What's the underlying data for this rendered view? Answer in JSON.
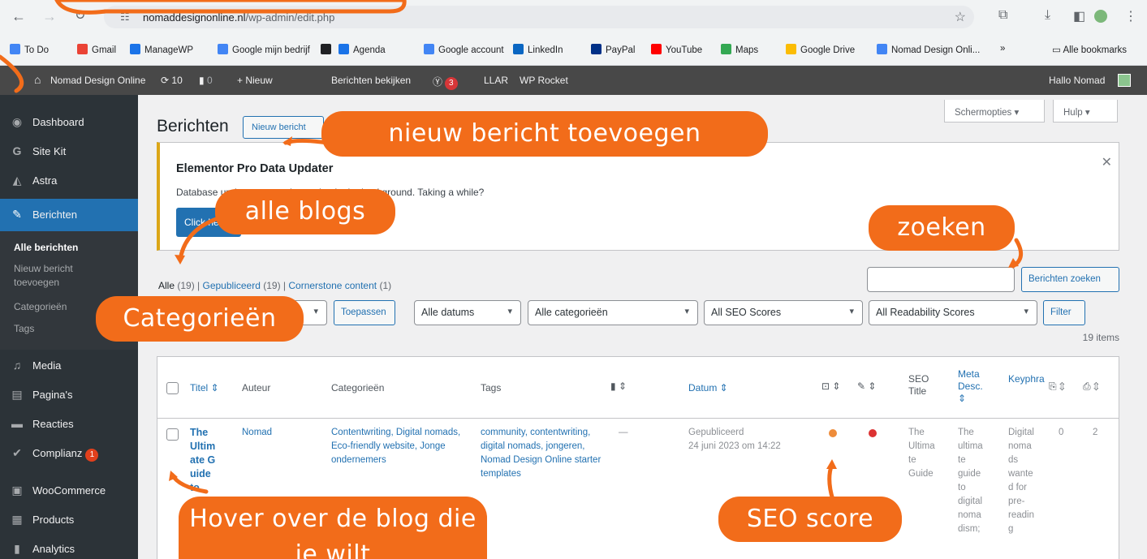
{
  "browser": {
    "url_host": "nomaddesignonline.nl",
    "url_path": "/wp-admin/edit.php",
    "bookmarks": [
      {
        "label": "To Do",
        "color": "#4285f4"
      },
      {
        "label": "Gmail",
        "color": "#ea4335"
      },
      {
        "label": "ManageWP",
        "color": "#1a73e8"
      },
      {
        "label": "Google mijn bedrijf",
        "color": "#4285f4"
      },
      {
        "label": "",
        "color": "#202124"
      },
      {
        "label": "Agenda",
        "color": "#1a73e8"
      },
      {
        "label": "Google account",
        "color": "#4285f4"
      },
      {
        "label": "LinkedIn",
        "color": "#0a66c2"
      },
      {
        "label": "PayPal",
        "color": "#003087"
      },
      {
        "label": "YouTube",
        "color": "#ff0000"
      },
      {
        "label": "Maps",
        "color": "#34a853"
      },
      {
        "label": "Google Drive",
        "color": "#fbbc04"
      },
      {
        "label": "Nomad Design Onli...",
        "color": "#4285f4"
      }
    ],
    "more_bookmarks": "»",
    "all_bookmarks": "Alle bookmarks"
  },
  "adminbar": {
    "site_name": "Nomad Design Online",
    "updates": "10",
    "comments": "0",
    "new": "+ Nieuw",
    "view_posts": "Berichten bekijken",
    "yoast_badge": "3",
    "llar": "LLAR",
    "wp_rocket": "WP Rocket",
    "greeting": "Hallo Nomad"
  },
  "sidebar": {
    "items": [
      {
        "label": "Dashboard",
        "icon": "dashboard-icon"
      },
      {
        "label": "Site Kit",
        "icon": "sitekit-icon"
      },
      {
        "label": "Astra",
        "icon": "astra-icon"
      },
      {
        "label": "Berichten",
        "icon": "pin-icon"
      },
      {
        "label": "Media",
        "icon": "media-icon"
      },
      {
        "label": "Pagina's",
        "icon": "page-icon"
      },
      {
        "label": "Reacties",
        "icon": "comment-icon"
      },
      {
        "label": "Complianz",
        "icon": "check-icon",
        "badge": "1"
      },
      {
        "label": "WooCommerce",
        "icon": "woo-icon"
      },
      {
        "label": "Products",
        "icon": "products-icon"
      },
      {
        "label": "Analytics",
        "icon": "analytics-icon"
      }
    ],
    "submenu": [
      "Alle berichten",
      "Nieuw bericht toevoegen",
      "Categorieën",
      "Tags"
    ]
  },
  "main": {
    "screen_options": "Schermopties ▾",
    "help": "Hulp ▾",
    "title": "Berichten",
    "new_post_button": "Nieuw bericht",
    "notice": {
      "title": "Elementor Pro Data Updater",
      "text": "Database update process is running in the background. Taking a while?",
      "button": "Click here"
    },
    "views": {
      "all": "Alle",
      "all_count": "(19)",
      "published": "Gepubliceerd",
      "published_count": "(19)",
      "cornerstone": "Cornerstone content",
      "cornerstone_count": "(1)"
    },
    "search_button": "Berichten zoeken",
    "apply_button": "Toepassen",
    "filters": {
      "dates": "Alle datums",
      "categories": "Alle categorieën",
      "seo": "All SEO Scores",
      "readability": "All Readability Scores",
      "filter_button": "Filter"
    },
    "items_count": "19 items",
    "table": {
      "headers": {
        "title": "Titel",
        "author": "Auteur",
        "categories": "Categorieën",
        "tags": "Tags",
        "date": "Datum",
        "seo_title": "SEO Title",
        "meta_desc": "Meta Desc.",
        "keyphrase": "Keyphra"
      },
      "row": {
        "title": "The Ultimate Guide to",
        "author": "Nomad",
        "categories": "Contentwriting, Digital nomads, Eco-friendly website, Jonge ondernemers",
        "tags": "community, contentwriting, digital nomads, jongeren, Nomad Design Online starter templates",
        "comments": "—",
        "status": "Gepubliceerd",
        "date": "24 juni 2023 om 14:22",
        "seo_title": "The Ultima te Guide",
        "meta_desc": "The ultima te guide to digital noma dism;",
        "keyphrase": "Digital noma ds wante d for pre- readin g",
        "linked": "0",
        "linking": "2",
        "seo_color": "#ee8c3a",
        "readability_color": "#dc3232"
      }
    }
  },
  "callouts": {
    "new_post": "nieuw bericht toevoegen",
    "all_blogs": "alle blogs",
    "search": "zoeken",
    "categories": "Categorieën",
    "hover": "Hover over de blog die je wilt",
    "seo": "SEO score"
  }
}
